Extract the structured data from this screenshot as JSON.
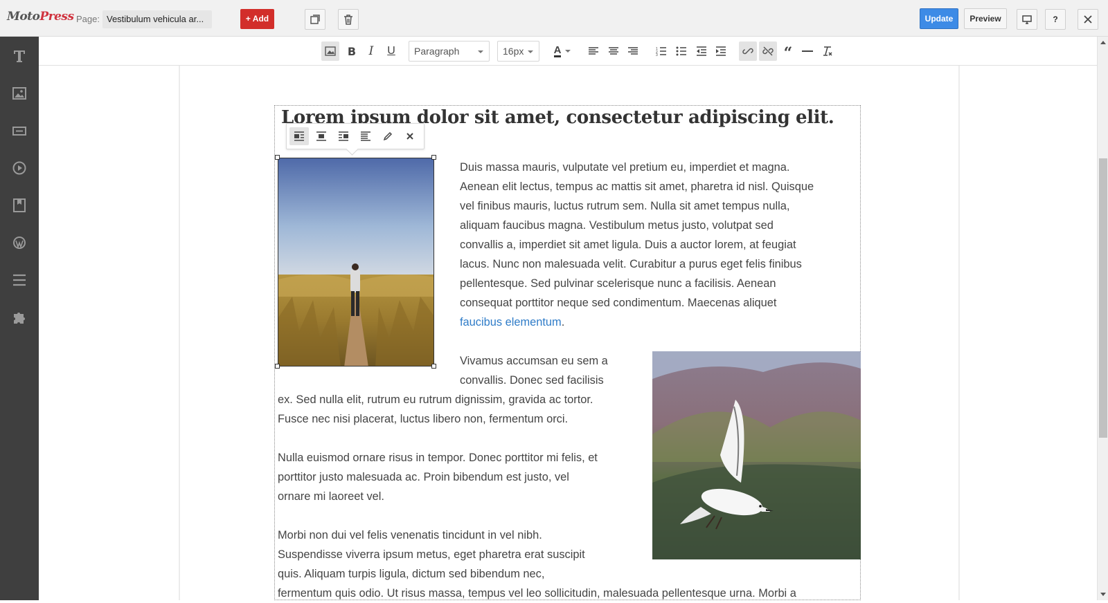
{
  "app": {
    "logo_moto": "Moto",
    "logo_press": "Press"
  },
  "header": {
    "page_label": "Page:",
    "page_value": "Vestibulum vehicula ar...",
    "add_label": "+ Add",
    "update_label": "Update",
    "preview_label": "Preview",
    "help_label": "?"
  },
  "toolbar": {
    "block_format": "Paragraph",
    "font_size": "16px",
    "font_color_icon": "A"
  },
  "content": {
    "heading": "Lorem ipsum dolor sit amet, consectetur adipiscing elit.",
    "para1": [
      "Duis massa mauris, vulputate vel pretium eu, imperdiet et magna.",
      "Aenean elit lectus, tempus ac mattis sit amet, pharetra id nisl. Quisque",
      "vel finibus mauris, luctus rutrum sem. Nulla sit amet tempus nulla,",
      "aliquam faucibus magna. Vestibulum metus justo, volutpat sed",
      "convallis a, imperdiet sit amet ligula. Duis a auctor lorem, at feugiat",
      "lacus. Nunc non malesuada velit. Curabitur a purus eget felis finibus",
      "pellentesque. Sed pulvinar scelerisque nunc a facilisis. Aenean",
      "consequat porttitor neque sed condimentum. Maecenas aliquet"
    ],
    "para1_link": "faucibus elementum",
    "para1_end": ".",
    "para2": [
      "Vivamus accumsan eu sem a",
      "convallis. Donec sed facilisis",
      "ex. Sed nulla elit, rutrum eu rutrum dignissim, gravida ac tortor.",
      "Fusce nec nisi placerat, luctus libero non, fermentum orci."
    ],
    "para3": [
      "Nulla euismod ornare risus in tempor. Donec porttitor mi felis, et",
      "porttitor justo malesuada ac. Proin bibendum est justo, vel",
      "ornare mi laoreet vel."
    ],
    "para4": [
      "Morbi non dui vel felis venenatis tincidunt in vel nibh.",
      "Suspendisse viverra ipsum metus, eget pharetra erat suscipit",
      "quis. Aliquam turpis ligula, dictum sed bibendum nec,",
      "fermentum quis odio. Ut risus massa, tempus vel leo sollicitudin, malesuada pellentesque urna. Morbi a"
    ]
  },
  "colors": {
    "accent_red": "#d22e2a",
    "update_blue": "#3d8be6",
    "sidebar_bg": "#3f3f3f",
    "link_blue": "#2f7cc8"
  },
  "icons": {
    "sidebar": [
      "text-icon",
      "image-icon",
      "button-icon",
      "video-icon",
      "bookmark-icon",
      "wordpress-icon",
      "list-icon",
      "puzzle-icon"
    ],
    "topbar": [
      "duplicate-icon",
      "trash-icon",
      "desktop-icon",
      "close-icon"
    ]
  }
}
